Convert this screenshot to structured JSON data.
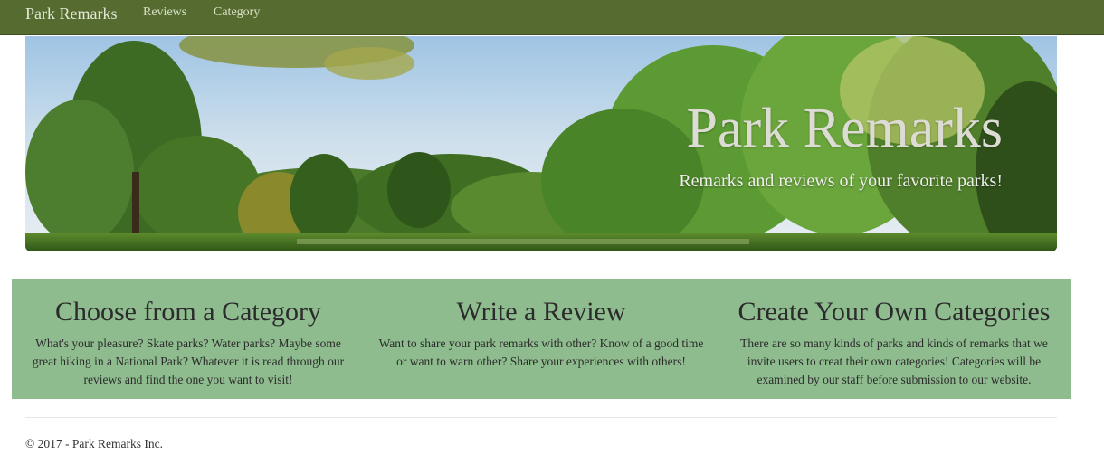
{
  "navbar": {
    "brand": "Park Remarks",
    "links": [
      "Reviews",
      "Category"
    ],
    "background": "#556b2f"
  },
  "hero": {
    "title": "Park Remarks",
    "subtitle": "Remarks and reviews of your favorite parks!"
  },
  "features": [
    {
      "heading": "Choose from a Category",
      "text": "What's your pleasure? Skate parks? Water parks? Maybe some great hiking in a National Park? Whatever it is read through our reviews and find the one you want to visit!"
    },
    {
      "heading": "Write a Review",
      "text": "Want to share your park remarks with other? Know of a good time or want to warn other? Share your experiences with others!"
    },
    {
      "heading": "Create Your Own Categories",
      "text": "There are so many kinds of parks and kinds of remarks that we invite users to creat their own categories! Categories will be examined by our staff before submission to our website."
    }
  ],
  "features_background": "#8fbc8f",
  "footer": {
    "text": "© 2017 - Park Remarks Inc."
  }
}
